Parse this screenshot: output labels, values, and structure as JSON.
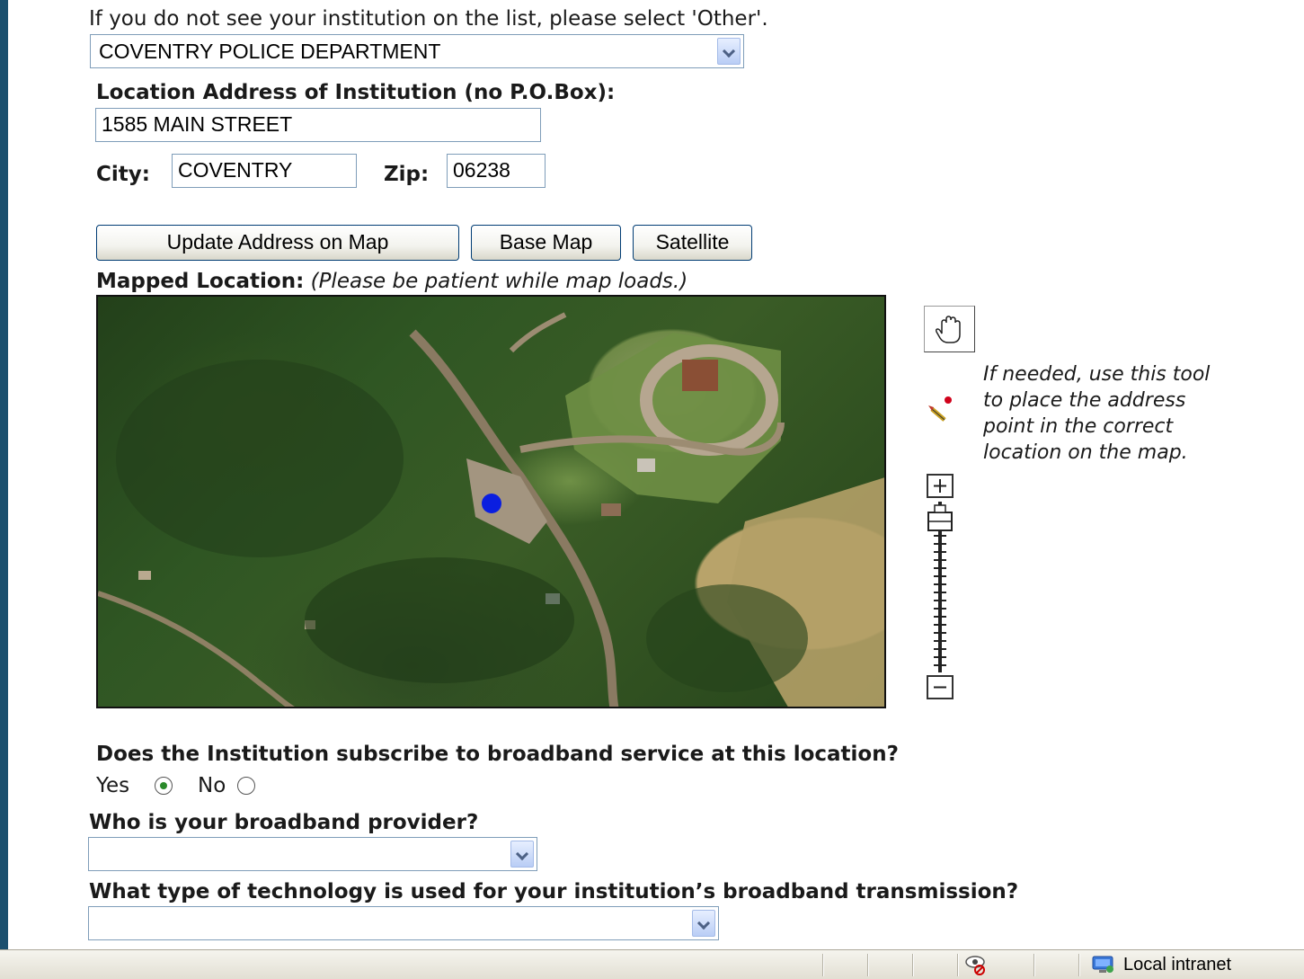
{
  "institution": {
    "hint": "If you do not see your institution on the list, please select 'Other'.",
    "selected": "COVENTRY POLICE DEPARTMENT"
  },
  "address": {
    "label": "Location Address of Institution (no P.O.Box):",
    "value": "1585 MAIN STREET",
    "city_label": "City:",
    "city_value": "COVENTRY",
    "zip_label": "Zip:",
    "zip_value": "06238"
  },
  "map_buttons": {
    "update": "Update Address on Map",
    "base": "Base Map",
    "satellite": "Satellite"
  },
  "mapped": {
    "label": "Mapped Location:",
    "note": "(Please be patient while map loads.)"
  },
  "tool_help": {
    "line1": "If needed, use this tool",
    "line2": "to place the address",
    "line3": "point in the correct",
    "line4": "location on the map."
  },
  "icons": {
    "pan": "hand-icon",
    "place_point": "pencil-point-icon",
    "zoom_in": "plus-icon",
    "zoom_out": "minus-icon"
  },
  "broadband": {
    "question": "Does the Institution subscribe to broadband service at this location?",
    "yes_label": "Yes",
    "no_label": "No",
    "selected": "Yes"
  },
  "provider": {
    "question": "Who is your broadband provider?",
    "selected": ""
  },
  "technology": {
    "question": "What type of technology is used for your institution’s broadband transmission?",
    "selected": ""
  },
  "statusbar": {
    "zone": "Local intranet"
  },
  "colors": {
    "frame": "#1b4f6e",
    "marker": "#0a1ee0"
  }
}
